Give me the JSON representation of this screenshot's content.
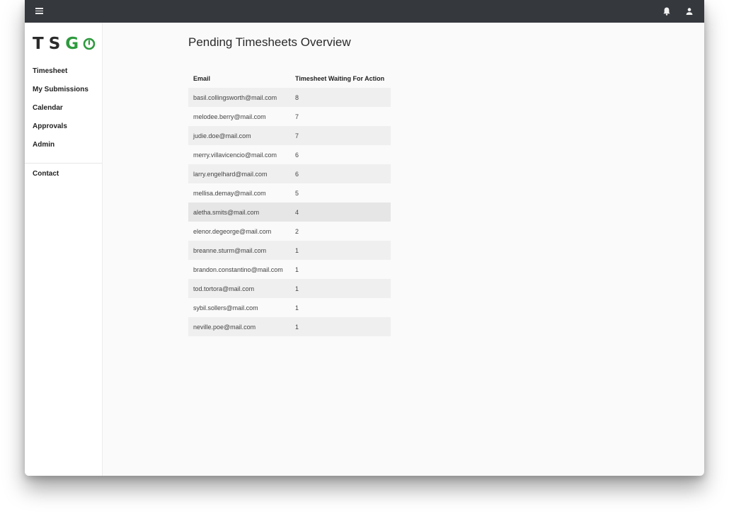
{
  "app": {
    "logo_letters": [
      "T",
      "S",
      "G"
    ],
    "logo_accent_color": "#2e9a3e",
    "topbar_color": "#35383d"
  },
  "topbar": {
    "menu_icon": "hamburger-menu-icon",
    "notification_icon": "bell-icon",
    "account_icon": "user-icon"
  },
  "sidebar": {
    "items": [
      {
        "label": "Timesheet"
      },
      {
        "label": "My Submissions"
      },
      {
        "label": "Calendar"
      },
      {
        "label": "Approvals"
      },
      {
        "label": "Admin"
      }
    ],
    "secondary": [
      {
        "label": "Contact"
      }
    ]
  },
  "main": {
    "title": "Pending Timesheets Overview",
    "table": {
      "headers": [
        "Email",
        "Timesheet Waiting For Action"
      ],
      "rows": [
        {
          "email": "basil.collingsworth@mail.com",
          "count": "8"
        },
        {
          "email": "melodee.berry@mail.com",
          "count": "7"
        },
        {
          "email": "judie.doe@mail.com",
          "count": "7"
        },
        {
          "email": "merry.villavicencio@mail.com",
          "count": "6"
        },
        {
          "email": "larry.engelhard@mail.com",
          "count": "6"
        },
        {
          "email": "mellisa.demay@mail.com",
          "count": "5"
        },
        {
          "email": "aletha.smits@mail.com",
          "count": "4"
        },
        {
          "email": "elenor.degeorge@mail.com",
          "count": "2"
        },
        {
          "email": "breanne.sturm@mail.com",
          "count": "1"
        },
        {
          "email": "brandon.constantino@mail.com",
          "count": "1"
        },
        {
          "email": "tod.tortora@mail.com",
          "count": "1"
        },
        {
          "email": "sybil.sollers@mail.com",
          "count": "1"
        },
        {
          "email": "neville.poe@mail.com",
          "count": "1"
        }
      ]
    }
  }
}
